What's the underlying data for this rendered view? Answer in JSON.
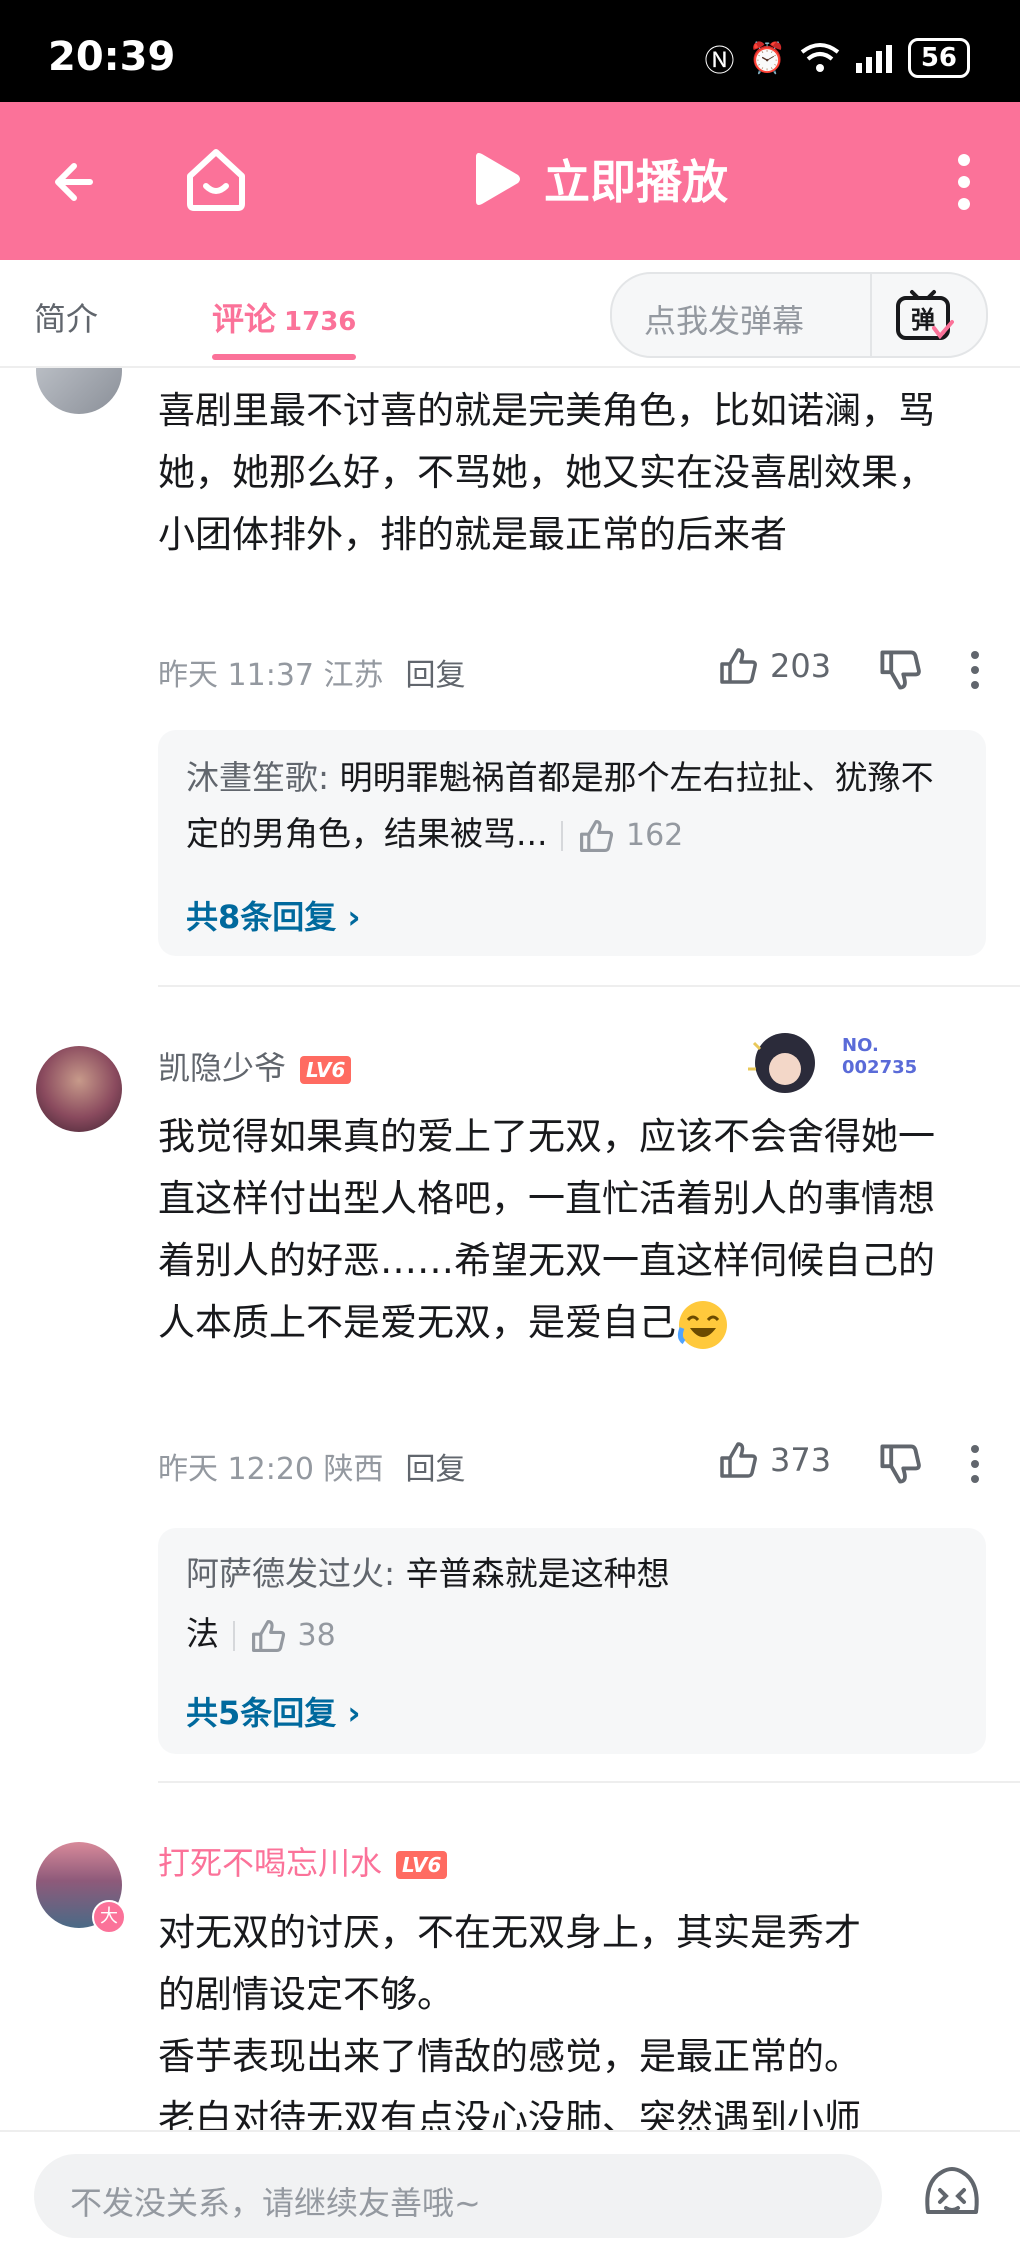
{
  "status_bar": {
    "time": "20:39",
    "battery": "56"
  },
  "app_bar": {
    "play_label": "立即播放"
  },
  "tabs": {
    "intro": "简介",
    "comments": "评论",
    "comment_count": "1736"
  },
  "danmaku": {
    "label": "点我发弹幕",
    "icon_label": "弹"
  },
  "comments": [
    {
      "text": "喜剧里最不讨喜的就是完美角色，比如诺澜，骂她，她那么好，不骂她，她又实在没喜剧效果，小团体排外，排的就是最正常的后来者",
      "meta": "昨天 11:37 江苏",
      "reply_label": "回复",
      "likes": "203",
      "sub_reply": {
        "name": "沐晝笙歌",
        "text": "明明罪魁祸首都是那个左右拉扯、犹豫不定的男角色，结果被骂...",
        "likes": "162"
      },
      "total_replies": "共8条回复"
    },
    {
      "username": "凯隐少爷",
      "level": "LV6",
      "badge_no": "NO.",
      "badge_num": "002735",
      "text": "我觉得如果真的爱上了无双，应该不会舍得她一直这样付出型人格吧，一直忙活着别人的事情想着别人的好恶……希望无双一直这样伺候自己的人本质上不是爱无双，是爱自己",
      "meta": "昨天 12:20 陕西",
      "reply_label": "回复",
      "likes": "373",
      "sub_reply": {
        "name": "阿萨德发过火",
        "text_line1": "辛普森就是这种想",
        "text_line2": "法",
        "likes": "38"
      },
      "total_replies": "共5条回复"
    },
    {
      "username": "打死不喝忘川水",
      "level": "LV6",
      "avatar_badge": "大",
      "text_lines": [
        "对无双的讨厌，不在无双身上，其实是秀才",
        "的剧情设定不够。",
        "香芋表现出来了情敌的感觉，是最正常的。",
        "老白对待无双有点没心没肺、突然遇到小师"
      ]
    }
  ],
  "bottom_bar": {
    "placeholder": "不发没关系，请继续友善哦~"
  },
  "colors": {
    "brand_pink": "#fb7299",
    "reply_link": "#00699d",
    "level_badge": "#ff6b61"
  }
}
